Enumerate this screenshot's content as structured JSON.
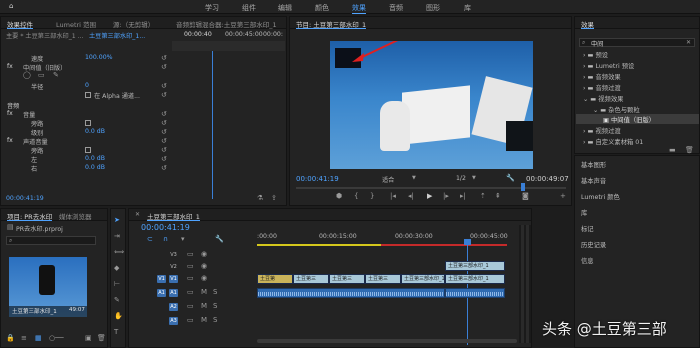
{
  "topbar": {
    "workspaces": [
      "学习",
      "组件",
      "编辑",
      "颜色",
      "效果",
      "音频",
      "图形",
      "库"
    ],
    "active": "效果"
  },
  "effect_controls": {
    "tabs": [
      "效果控件",
      "Lumetri 范围",
      "源:（无剪辑）",
      "音频剪辑混合器:土豆第三部水印_1"
    ],
    "master": "主要 * 土豆第三部水印_1 ...",
    "clip": "土豆第三部水印_1...",
    "ruler": [
      "00:00:40",
      "00:00:45:00",
      "00:00:"
    ],
    "speed_label": "速度",
    "speed_value": "100.00%",
    "fx_median": "中间值（旧版）",
    "radius_label": "半径",
    "radius_value": "0",
    "alpha_label": "在 Alpha 通道...",
    "audio_header": "音频",
    "volume_label": "音量",
    "bypass_label": "旁路",
    "level_label": "级别",
    "level_value": "0.0 dB",
    "channel_volume": "声道音量",
    "left_label": "左",
    "left_value": "0.0 dB",
    "right_label": "右",
    "right_value": "0.0 dB",
    "time": "00:00:41:19"
  },
  "program": {
    "title": "节目: 土豆第三部水印_1",
    "current_time": "00:00:41:19",
    "fit": "适合",
    "ratio": "1/2",
    "duration": "00:00:49:07"
  },
  "project": {
    "tabs": [
      "项目: PR去水印",
      "媒体浏览器"
    ],
    "file": "PR去水印.prproj",
    "clip_name": "土豆第三部水印_1",
    "clip_duration": "49:07"
  },
  "timeline": {
    "tab": "土豆第三部水印_1",
    "time": "00:00:41:19",
    "ruler": [
      ":00:00",
      "00:00:15:00",
      "00:00:30:00",
      "00:00:45:00"
    ],
    "tracks": [
      "V3",
      "V2",
      "V1",
      "A1",
      "A2",
      "A3"
    ],
    "video_clips": [
      "土豆第",
      "土豆第三",
      "土豆第三",
      "土豆第三",
      "土豆第三部水印_1",
      "土豆第三部水印_1",
      "土豆第三部水印_1"
    ],
    "audio_db": [
      "0",
      "0"
    ]
  },
  "effects": {
    "title": "效果",
    "search_value": "中间",
    "items": [
      "预设",
      "Lumetri 预设",
      "音频效果",
      "音频过渡",
      "视频效果",
      "杂色与颗粒",
      "中间值（旧版）",
      "视频过渡",
      "自定义素材箱 01"
    ]
  },
  "side_panels": [
    "基本图形",
    "基本声音",
    "Lumetri 颜色",
    "库",
    "标记",
    "历史记录",
    "信息"
  ],
  "watermark": "头条 @土豆第三部",
  "colors": {
    "accent": "#4fa3ff",
    "clip_video": "#a8c8d8",
    "clip_audio": "#2f6bb2",
    "playhead": "#3a7fd6",
    "arrow": "#e02020"
  }
}
